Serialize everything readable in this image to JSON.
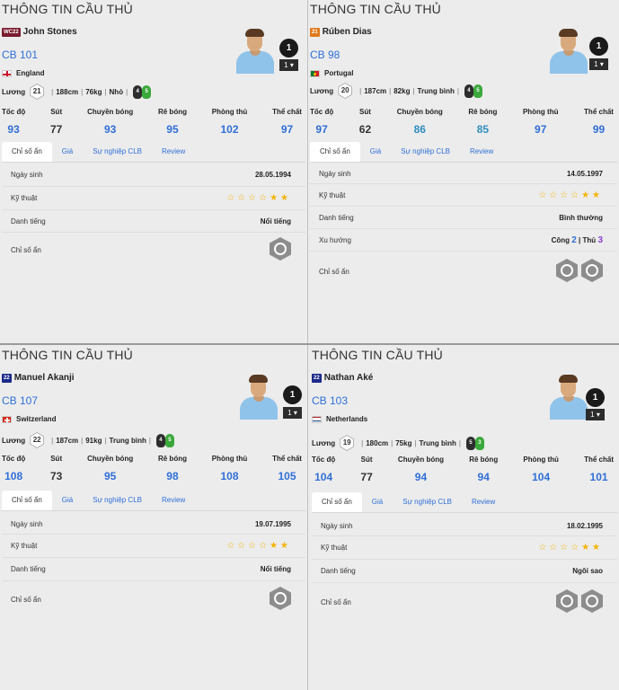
{
  "labels": {
    "title": "THÔNG TIN CẦU THỦ",
    "attrs": [
      "Tốc độ",
      "Sút",
      "Chuyền bóng",
      "Rê bóng",
      "Phòng thủ",
      "Thể chất"
    ],
    "tabs": [
      "Chỉ số ẩn",
      "Giá",
      "Sự nghiệp CLB",
      "Review"
    ],
    "luong": "Lương",
    "birth": "Ngày sinh",
    "skill": "Kỹ thuật",
    "rep": "Danh tiếng",
    "trend": "Xu hướng",
    "hidden": "Chỉ số ẩn"
  },
  "players": [
    {
      "name": "John Stones",
      "season": "WC22",
      "season_color": "#7a1b2e",
      "pos": "CB 101",
      "nation": "England",
      "flag": "england",
      "level": "1",
      "salary": "21",
      "height": "188cm",
      "weight": "76kg",
      "body": "Nhỏ",
      "feet": [
        "4",
        "5"
      ],
      "attrs": [
        "93",
        "77",
        "93",
        "95",
        "102",
        "97"
      ],
      "attr_colors": [
        "#2f6fd6",
        "#333333",
        "#2f6fd6",
        "#2f6fd6",
        "#2f6fd6",
        "#2f6fd6"
      ],
      "birth": "28.05.1994",
      "stars_empty": "☆☆☆☆",
      "stars_full": "★★",
      "rep": "Nổi tiếng",
      "trend": null,
      "traits": [
        "trait-icon-1"
      ]
    },
    {
      "name": "Rúben Dias",
      "season": "21",
      "season_color": "#e07a1a",
      "pos": "CB 98",
      "nation": "Portugal",
      "flag": "portugal",
      "level": "1",
      "salary": "20",
      "height": "187cm",
      "weight": "82kg",
      "body": "Trung bình",
      "feet": [
        "4",
        "5"
      ],
      "attrs": [
        "97",
        "62",
        "86",
        "85",
        "97",
        "99"
      ],
      "attr_colors": [
        "#2f6fd6",
        "#333333",
        "#2f8fbf",
        "#2f8fbf",
        "#2f6fd6",
        "#2f6fd6"
      ],
      "birth": "14.05.1997",
      "stars_empty": "☆☆☆☆",
      "stars_full": "★★",
      "rep": "Bình thường",
      "trend": {
        "atk_label": "Công",
        "atk": "2",
        "sep": "|",
        "def_label": "Thủ",
        "def": "3"
      },
      "traits": [
        "trait-icon-1",
        "trait-icon-2"
      ]
    },
    {
      "name": "Manuel Akanji",
      "season": "22",
      "season_color": "#1c2a8a",
      "pos": "CB 107",
      "nation": "Switzerland",
      "flag": "switzerland",
      "level": "1",
      "salary": "22",
      "height": "187cm",
      "weight": "91kg",
      "body": "Trung bình",
      "feet": [
        "4",
        "5"
      ],
      "attrs": [
        "108",
        "73",
        "95",
        "98",
        "108",
        "105"
      ],
      "attr_colors": [
        "#2f6fd6",
        "#333333",
        "#2f6fd6",
        "#2f6fd6",
        "#2f6fd6",
        "#2f6fd6"
      ],
      "birth": "19.07.1995",
      "stars_empty": "☆☆☆☆",
      "stars_full": "★★",
      "rep": "Nổi tiếng",
      "trend": null,
      "traits": [
        "trait-icon-1"
      ]
    },
    {
      "name": "Nathan Aké",
      "season": "22",
      "season_color": "#1c2a8a",
      "pos": "CB 103",
      "nation": "Netherlands",
      "flag": "netherlands",
      "level": "1",
      "salary": "19",
      "height": "180cm",
      "weight": "75kg",
      "body": "Trung bình",
      "feet": [
        "5",
        "3"
      ],
      "attrs": [
        "104",
        "77",
        "94",
        "94",
        "104",
        "101"
      ],
      "attr_colors": [
        "#2f6fd6",
        "#333333",
        "#2f6fd6",
        "#2f6fd6",
        "#2f6fd6",
        "#2f6fd6"
      ],
      "birth": "18.02.1995",
      "stars_empty": "☆☆☆☆",
      "stars_full": "★★",
      "rep": "Ngôi sao",
      "trend": null,
      "traits": [
        "trait-icon-1",
        "trait-icon-2"
      ]
    }
  ]
}
